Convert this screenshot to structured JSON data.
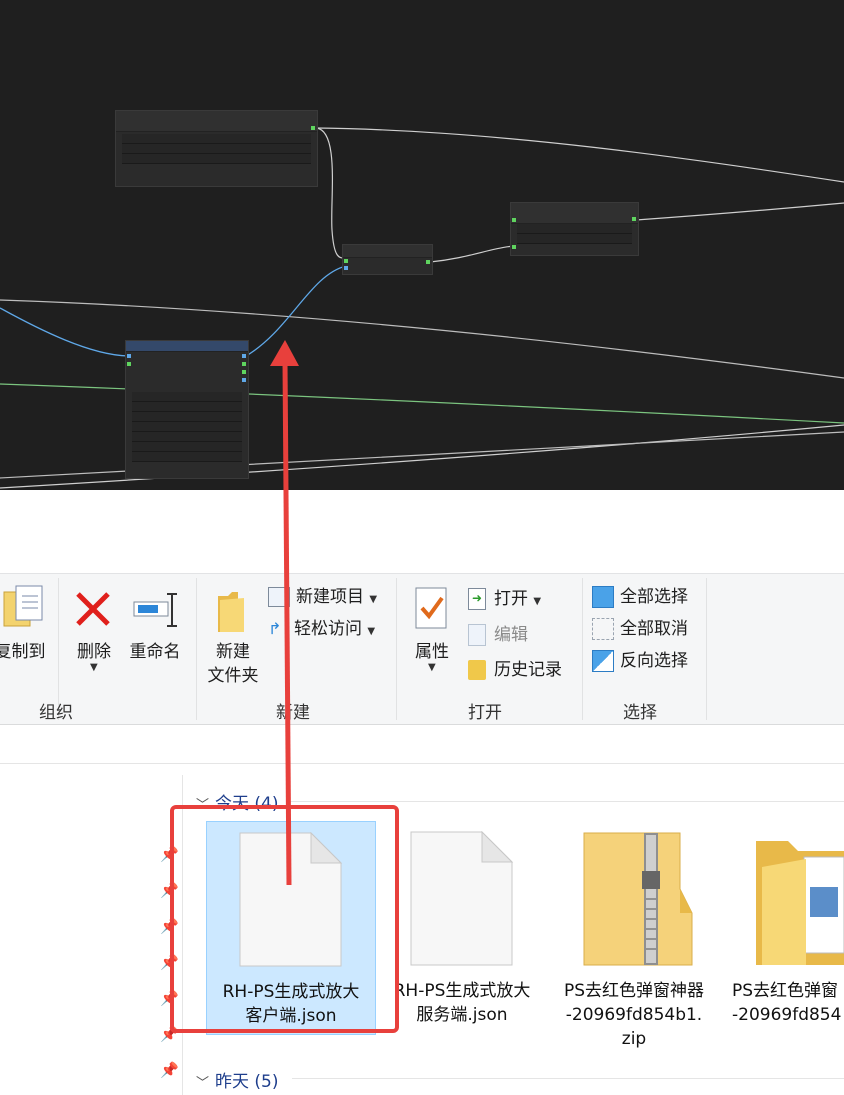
{
  "ribbon": {
    "organize": {
      "label": "组织",
      "copy_to": "复制到",
      "delete": "删除",
      "rename": "重命名"
    },
    "new": {
      "label": "新建",
      "new_folder_line1": "新建",
      "new_folder_line2": "文件夹",
      "new_item": "新建项目",
      "easy_access": "轻松访问"
    },
    "open": {
      "label": "打开",
      "properties": "属性",
      "open": "打开",
      "edit": "编辑",
      "history": "历史记录"
    },
    "select": {
      "label": "选择",
      "select_all": "全部选择",
      "select_none": "全部取消",
      "invert": "反向选择"
    }
  },
  "file_list": {
    "group_today": "今天 (4)",
    "group_yesterday": "昨天 (5)",
    "files": [
      {
        "line1": "RH-PS生成式放大",
        "line2": "客户端.json",
        "line3": "",
        "icon": "json-file-icon"
      },
      {
        "line1": "RH-PS生成式放大",
        "line2": "服务端.json",
        "line3": "",
        "icon": "json-file-icon"
      },
      {
        "line1": "PS去红色弹窗神器",
        "line2": "-20969fd854b1.",
        "line3": "zip",
        "icon": "zip-folder-icon"
      },
      {
        "line1": "PS去红色弹窗",
        "line2": "-20969fd854",
        "line3": "",
        "icon": "folder-icon"
      }
    ]
  },
  "colors": {
    "annotation_red": "#e8403c",
    "selection_bg": "#cce8ff",
    "canvas_bg": "#1f1f1f",
    "link_blue": "#5fa8e8",
    "link_green": "#7bc47f"
  }
}
